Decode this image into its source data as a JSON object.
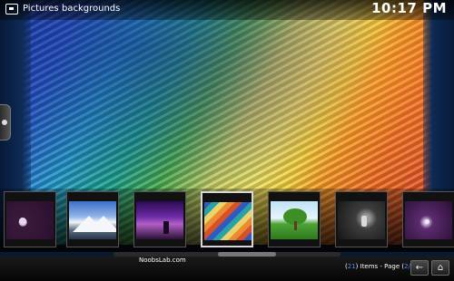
{
  "header": {
    "section": "Pictures",
    "folder": "backgrounds",
    "clock": "10:17 PM"
  },
  "thumbnails": [
    {
      "name": "purple-flower",
      "style": "t-purple"
    },
    {
      "name": "snow-mountain",
      "style": "t-mountain"
    },
    {
      "name": "violet-sunset",
      "style": "t-sunset"
    },
    {
      "name": "rainbow-knit",
      "style": "t-rainbow",
      "selected": true
    },
    {
      "name": "green-tree",
      "style": "t-tree"
    },
    {
      "name": "dark-leaf",
      "style": "t-dark"
    },
    {
      "name": "violet-glow",
      "style": "t-violet"
    }
  ],
  "footer": {
    "brand": "NoobsLab.com",
    "item_count": "21",
    "items_label": "Items - Page",
    "page": "2/4"
  },
  "colors": {
    "accent": "#4d8cff",
    "side_panel": "#0e2a55"
  },
  "icons": {
    "back": "back-arrow-icon",
    "home": "home-icon"
  }
}
